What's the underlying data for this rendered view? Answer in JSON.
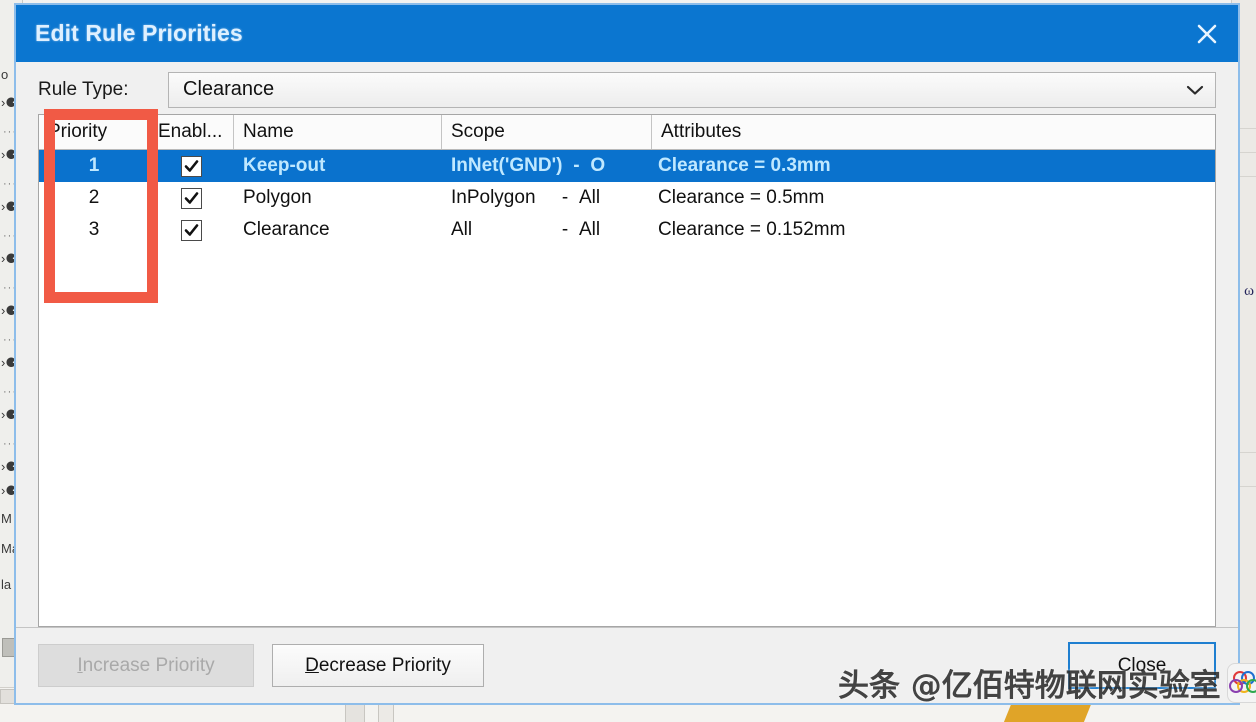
{
  "window": {
    "title": "Edit Rule Priorities",
    "close_icon": "close-x-icon",
    "title_bar_color": "#0b76d0",
    "border_color": "#8dbdea"
  },
  "rule_type": {
    "label": "Rule Type:",
    "selected": "Clearance",
    "chevron_icon": "chevron-down-icon"
  },
  "grid": {
    "headers": [
      {
        "key": "priority",
        "label": "Priority"
      },
      {
        "key": "enabled",
        "label": "Enabl..."
      },
      {
        "key": "name",
        "label": "Name"
      },
      {
        "key": "scope",
        "label": "Scope"
      },
      {
        "key": "attributes",
        "label": "Attributes"
      }
    ],
    "rows": [
      {
        "priority": "1",
        "enabled": true,
        "name": "Keep-out",
        "scope_source": "InNet('GND')",
        "scope_dash": "-",
        "scope_target": "O",
        "attributes": "Clearance = 0.3mm",
        "selected": true
      },
      {
        "priority": "2",
        "enabled": true,
        "name": "Polygon",
        "scope_source": "InPolygon",
        "scope_dash": "-",
        "scope_target": "All",
        "attributes": "Clearance = 0.5mm",
        "selected": false
      },
      {
        "priority": "3",
        "enabled": true,
        "name": "Clearance",
        "scope_source": "All",
        "scope_dash": "-",
        "scope_target": "All",
        "attributes": "Clearance = 0.152mm",
        "selected": false
      }
    ],
    "selection_color": "#0a72cd",
    "selection_text_color": "#bfe8ff",
    "check_icon": "checkmark-icon"
  },
  "footer": {
    "increase_priority": {
      "accel": "I",
      "rest": "ncrease Priority",
      "enabled": false
    },
    "decrease_priority": {
      "accel": "D",
      "rest": "ecrease Priority",
      "enabled": true
    },
    "close": "Close"
  },
  "annotation": {
    "shape": "rectangle",
    "color": "#f15a45",
    "target": "Priority column"
  },
  "watermark": {
    "text": "头条 @亿佰特物联网实验室",
    "logo_icon": "brand-logo-icon"
  },
  "background": {
    "left_glyphs": [
      "o",
      "...",
      "...",
      "...",
      "...",
      "...",
      "...",
      "M",
      "Ma",
      "la",
      "..."
    ],
    "right_letter": "ω"
  }
}
